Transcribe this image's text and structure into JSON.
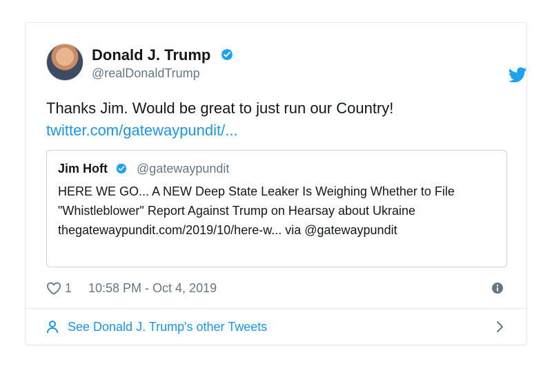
{
  "author": {
    "name": "Donald J. Trump",
    "handle": "@realDonaldTrump"
  },
  "tweet": {
    "text": "Thanks Jim. Would be great to just run our Country!",
    "link": "twitter.com/gatewaypundit/..."
  },
  "quoted_tweet": {
    "name": "Jim Hoft",
    "handle": "@gatewaypundit",
    "text": "HERE WE GO... A NEW Deep State Leaker Is Weighing Whether to File \"Whistleblower\" Report Against Trump on Hearsay about Ukraine thegatewaypundit.com/2019/10/here-w... via @gatewaypundit"
  },
  "meta": {
    "like_count": "1",
    "timestamp": "10:58 PM - Oct 4, 2019"
  },
  "footer": {
    "link_label": "See Donald J. Trump's other Tweets"
  },
  "icons": {
    "avatar": "avatar",
    "verified": "verified-badge-icon",
    "twitter": "twitter-bird-icon",
    "heart": "heart-icon",
    "info": "info-icon",
    "person": "person-icon",
    "chevron": "chevron-right-icon"
  },
  "colors": {
    "link": "#1b95e0",
    "muted": "#657786",
    "border": "#e1e8ed"
  }
}
